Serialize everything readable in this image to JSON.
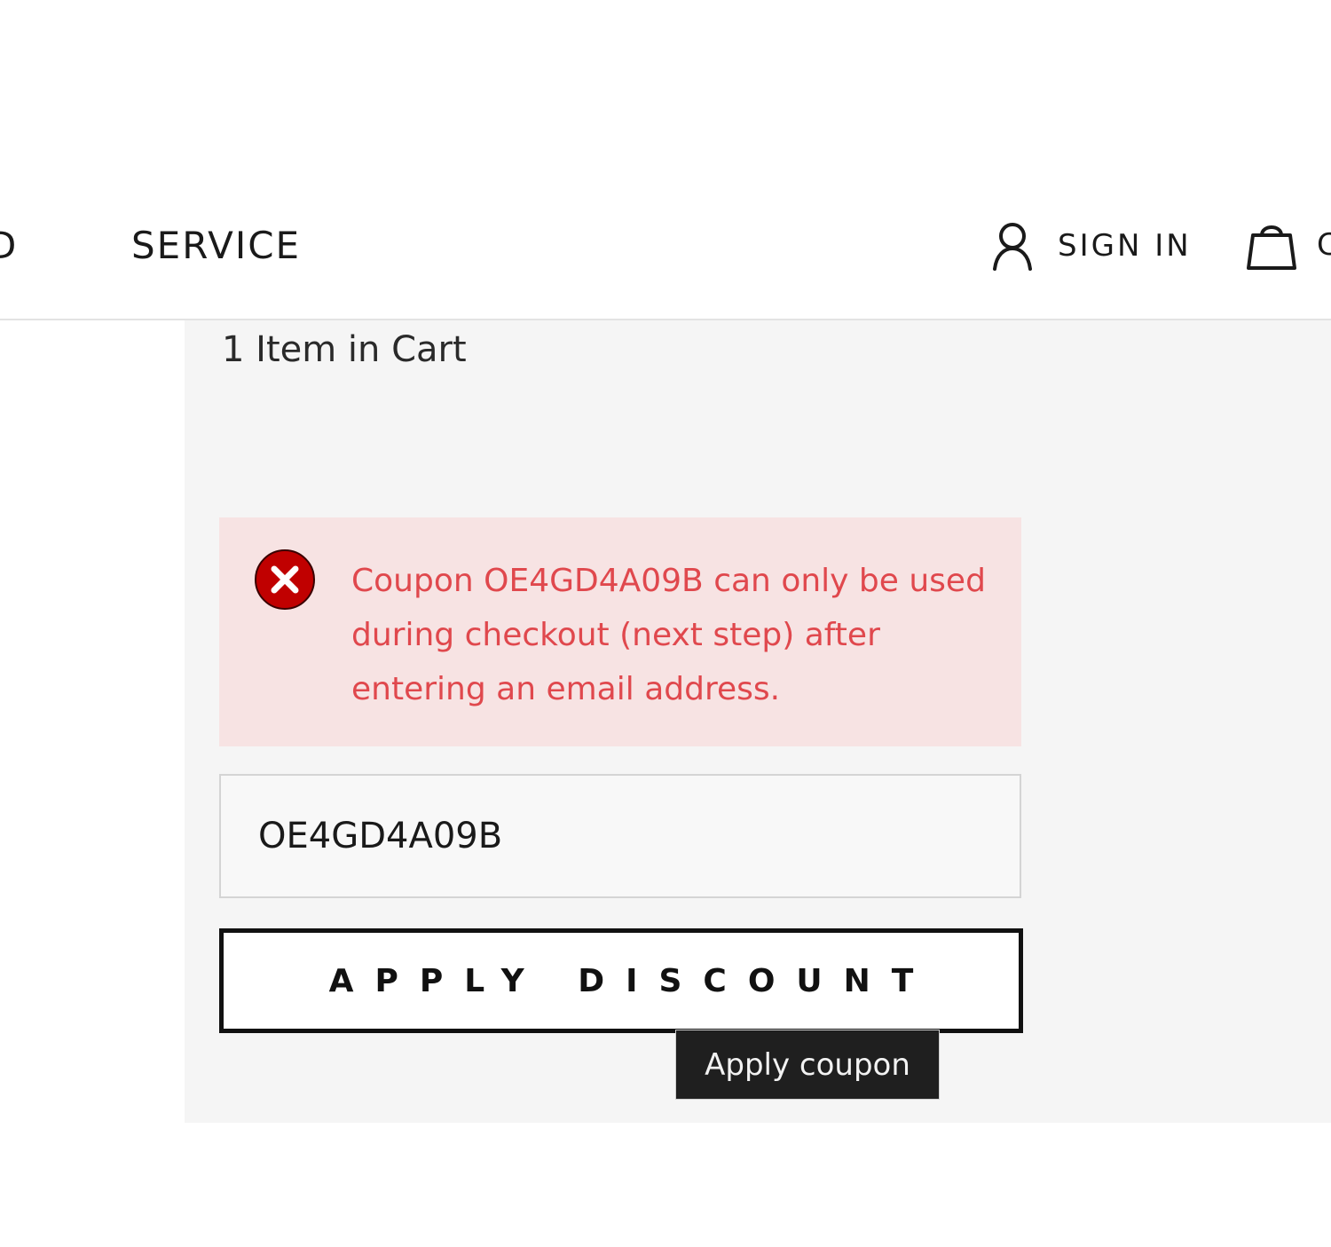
{
  "header": {
    "nav_cut_label": "D",
    "nav_service_label": "SERVICE",
    "signin_label": "SIGN IN",
    "cart_label_cut": "C",
    "icons": {
      "user": "user-icon",
      "cart": "shopping-bag-icon"
    }
  },
  "cart": {
    "count_label": "1 Item in Cart"
  },
  "error": {
    "icon": "error-x-icon",
    "message": "Coupon OE4GD4A09B can only be used during checkout (next step) after entering an email address.",
    "text_color": "#e0484d",
    "background_color": "#f7e3e3",
    "icon_color": "#c00000"
  },
  "coupon": {
    "value": "OE4GD4A09B"
  },
  "apply_button": {
    "label": "APPLY DISCOUNT"
  },
  "tooltip": {
    "text": "Apply coupon"
  }
}
